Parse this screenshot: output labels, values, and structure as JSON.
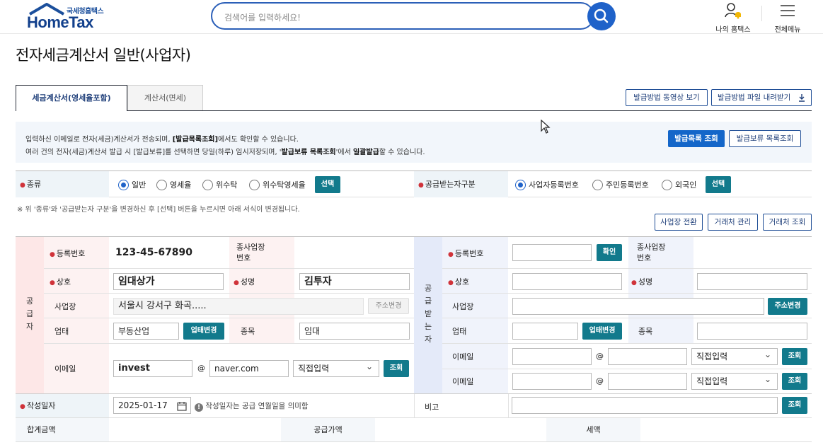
{
  "header": {
    "logo_small": "국세청홈택스",
    "logo_big": "HomeTax",
    "search_placeholder": "검색어를 입력하세요!",
    "my_hometax": "나의 홈택스",
    "all_menu": "전체메뉴"
  },
  "page_title": "전자세금계산서 일반(사업자)",
  "tabs": [
    {
      "label": "세금계산서(영세율포함)",
      "active": true
    },
    {
      "label": "계산서(면세)",
      "active": false
    }
  ],
  "top_buttons": {
    "video": "발급방법 동영상 보기",
    "download": "발급방법 파일 내려받기"
  },
  "info": {
    "line1_pre": "입력하신 이메일로 전자(세금)계산서가 전송되며, ",
    "line1_bold": "[발급목록조회]",
    "line1_post": "에서도 확인할 수 있습니다.",
    "line2_pre": "여러 건의 전자(세금)계산서 발급 시 [발급보류]를 선택하면 당일(하루) 임시저장되며, '",
    "line2_bold1": "발급보류 목록조회",
    "line2_mid": "'에서 ",
    "line2_bold2": "일괄발급",
    "line2_post": "할 수 있습니다.",
    "btn_list": "발급목록 조회",
    "btn_hold": "발급보류 목록조회"
  },
  "type_row": {
    "type_label": "종류",
    "type_options": [
      "일반",
      "영세율",
      "위수탁",
      "위수탁영세율"
    ],
    "type_selected": "일반",
    "select_btn": "선택",
    "receiver_label": "공급받는자구분",
    "receiver_options": [
      "사업자등록번호",
      "주민등록번호",
      "외국인"
    ],
    "receiver_selected": "사업자등록번호",
    "receiver_btn": "선택"
  },
  "note": "※ 위 '종류'와 '공급받는자 구분'을 변경하신 후 [선택] 버튼을 누르시면 아래 서식이 변경됩니다.",
  "partner_buttons": {
    "switch": "사업장 전환",
    "manage": "거래처 관리",
    "lookup": "거래처 조회"
  },
  "supplier": {
    "side_label": [
      "공",
      "급",
      "자"
    ],
    "reg_label": "등록번호",
    "reg_value": "123-45-67890",
    "sub_label": "종사업장\n번호",
    "name_label": "상호",
    "name_value": "임대상가",
    "ceo_label": "성명",
    "ceo_value": "김투자",
    "addr_label": "사업장",
    "addr_value": "서울시 강서구 화곡.....",
    "addr_btn": "주소변경",
    "biz_label": "업태",
    "biz_value": "부동산업",
    "biz_btn": "업태변경",
    "item_label": "종목",
    "item_value": "임대",
    "email_label": "이메일",
    "email_id": "invest",
    "email_at": "@",
    "email_domain": "naver.com",
    "email_select": "직접입력",
    "email_btn": "조회"
  },
  "receiver": {
    "side_label": [
      "공",
      "급",
      "받",
      "는",
      "자"
    ],
    "reg_label": "등록번호",
    "confirm_btn": "확인",
    "sub_label": "종사업장\n번호",
    "name_label": "상호",
    "ceo_label": "성명",
    "addr_label": "사업장",
    "addr_btn": "주소변경",
    "biz_label": "업태",
    "biz_btn": "업태변경",
    "item_label": "종목",
    "email_label": "이메일",
    "email_at": "@",
    "email_select": "직접입력",
    "email_btn": "조회",
    "email2_label": "이메일",
    "email2_select": "직접입력",
    "email2_btn": "조회"
  },
  "date_row": {
    "label": "작성일자",
    "value": "2025-01-17",
    "hint": "작성일자는 공급 연월일을 의미함",
    "remark_label": "비고",
    "remark_btn": "조회"
  },
  "sum_row": {
    "total_label": "합계금액",
    "supply_label": "공급가액",
    "tax_label": "세액"
  },
  "colors": {
    "brand_blue": "#1466c9",
    "teal": "#127a8c",
    "supplier_bg": "#fde7e7",
    "receiver_bg": "#e4eaf9"
  }
}
